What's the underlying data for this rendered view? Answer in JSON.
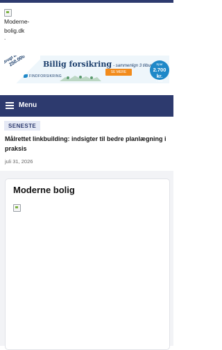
{
  "header": {
    "logo_alt": "Moderne-bolig.dk",
    "logo_suffix": "."
  },
  "ad": {
    "ribbon_text": "Brugt af over",
    "ribbon_number": "250.000",
    "title": "Billig forsikring",
    "subtitle": "- sammenlign 3 tilbud",
    "brand": "FINDFORSIKRING",
    "cta": "SE MERE",
    "badge_top": "Spar",
    "badge_amount": "2.700 kr.",
    "badge_bottom": "i snit",
    "colors": {
      "primary": "#1a3d6b",
      "accent": "#f28b1b",
      "badge": "#1e88c8"
    }
  },
  "nav": {
    "menu_label": "Menu",
    "menu_icon": "hamburger-icon",
    "background": "#2d3a6e"
  },
  "latest": {
    "tag": "SENESTE",
    "headline": "Målrettet linkbuilding: indsigter til bedre planlægning i praksis",
    "date": "juli 31, 2026"
  },
  "card": {
    "title": "Moderne bolig",
    "image_icon": "broken-image-icon"
  }
}
